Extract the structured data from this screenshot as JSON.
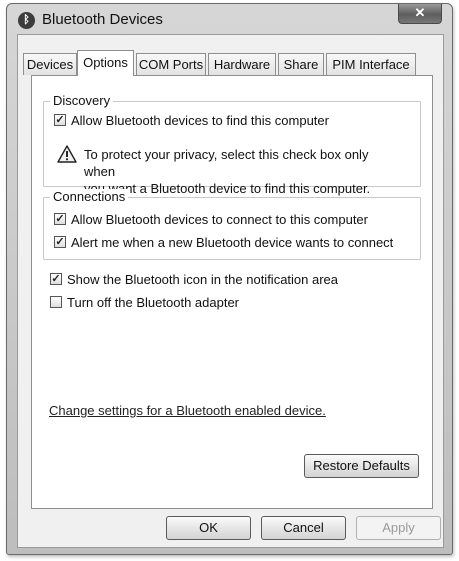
{
  "window": {
    "title": "Bluetooth Devices",
    "icon": "bluetooth-icon",
    "close_glyph": "✕"
  },
  "tabs": [
    {
      "label": "Devices",
      "active": false
    },
    {
      "label": "Options",
      "active": true
    },
    {
      "label": "COM Ports",
      "active": false
    },
    {
      "label": "Hardware",
      "active": false
    },
    {
      "label": "Share",
      "active": false
    },
    {
      "label": "PIM Interface",
      "active": false
    }
  ],
  "discovery": {
    "title": "Discovery",
    "allow_find": {
      "label": "Allow Bluetooth devices to find this computer",
      "checked": true
    },
    "warning_icon": "warning-icon",
    "warning_line1": "To protect your privacy, select this check box only when",
    "warning_line2": "you want a Bluetooth device to find this computer."
  },
  "connections": {
    "title": "Connections",
    "allow_connect": {
      "label": "Allow Bluetooth devices to connect to this computer",
      "checked": true
    },
    "alert_new": {
      "label": "Alert me when a new Bluetooth device wants to connect",
      "checked": true
    }
  },
  "options": {
    "show_icon": {
      "label": "Show the Bluetooth icon in the notification area",
      "checked": true
    },
    "turn_off": {
      "label": "Turn off the Bluetooth adapter",
      "checked": false
    }
  },
  "link_text": "Change settings for a Bluetooth enabled device.",
  "restore_defaults": "Restore Defaults",
  "buttons": {
    "ok": "OK",
    "cancel": "Cancel",
    "apply": "Apply",
    "apply_enabled": false
  },
  "check_glyph": "✓",
  "colors": {
    "panel_bg": "#ffffff",
    "dialog_bg": "#f0f0f0",
    "frame": "#c9c9c9"
  }
}
